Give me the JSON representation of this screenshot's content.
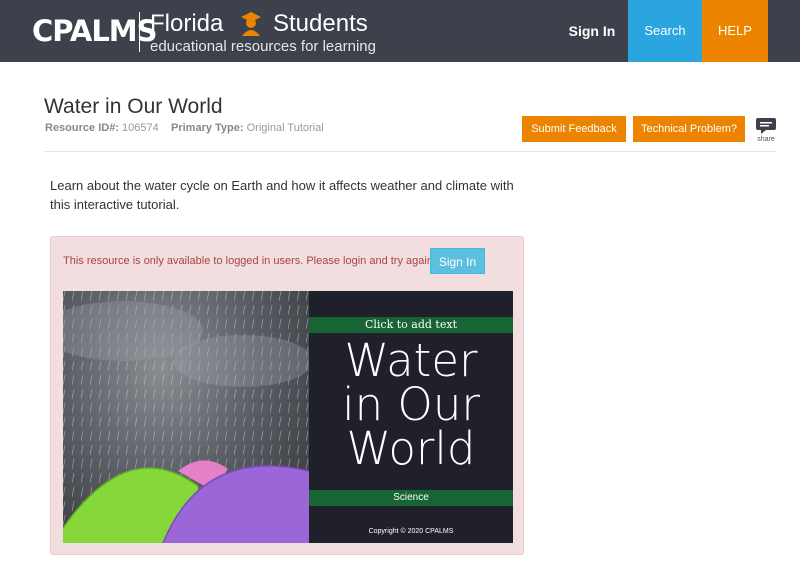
{
  "header": {
    "logo_text": "CPALMS",
    "brand_florida": "Florida",
    "brand_students": "Students",
    "brand_tagline": "educational resources for learning",
    "nav_signin": "Sign In",
    "nav_search": "Search",
    "nav_help": "HELP"
  },
  "resource": {
    "title": "Water in Our World",
    "id_label": "Resource ID#:",
    "id_value": "106574",
    "type_label": "Primary Type:",
    "type_value": "Original Tutorial",
    "submit_feedback": "Submit Feedback",
    "technical_problem": "Technical Problem?",
    "share_label": "share",
    "description": "Learn about the water cycle on Earth and how it affects weather and climate with this interactive tutorial."
  },
  "alert": {
    "message": "This resource is only available to logged in users. Please login and try again.",
    "signin_label": "Sign In"
  },
  "thumbnail": {
    "top_strip_text": "Click to add text",
    "title_line1": "Water",
    "title_line2": "in Our",
    "title_line3": "World",
    "subject": "Science",
    "copyright": "Copyright © 2020 CPALMS"
  },
  "colors": {
    "header_bg": "#3c414b",
    "search_blue": "#2aa5df",
    "help_orange": "#ec8400",
    "alert_bg": "#f2dede",
    "alert_text": "#a94442",
    "panel_green": "#176534"
  }
}
